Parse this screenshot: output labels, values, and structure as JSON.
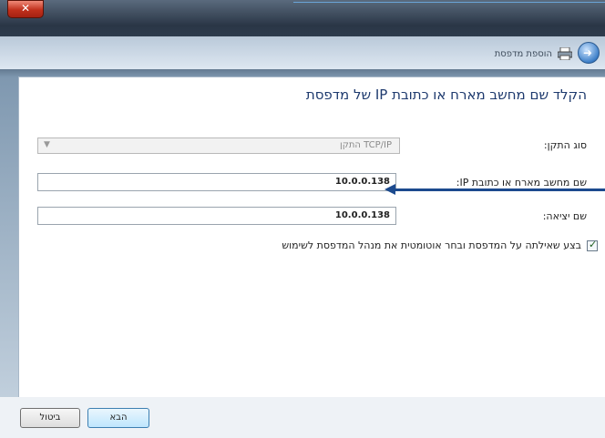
{
  "window": {
    "title": "הוספת מדפסת",
    "close_glyph": "✕",
    "back_icon": "back-arrow-icon",
    "printer_icon": "printer-icon"
  },
  "heading": "הקלד שם מחשב מארח או כתובת IP של מדפסת",
  "form": {
    "device_type_label": "סוג התקן:",
    "device_type_value": "התקן TCP/IP",
    "hostname_label": "שם מחשב מארח או כתובת IP:",
    "hostname_value": "10.0.0.138",
    "port_label": "שם יציאה:",
    "port_value": "10.0.0.138"
  },
  "checkbox": {
    "label": "בצע שאילתה על המדפסת ובחר אוטומטית את מנהל המדפסת לשימוש",
    "checked": true
  },
  "buttons": {
    "next": "הבא",
    "cancel": "ביטול"
  },
  "colors": {
    "annotation_arrow": "#1c4a8e",
    "close_button": "#c0301c",
    "heading_text": "#1e3a6e"
  }
}
